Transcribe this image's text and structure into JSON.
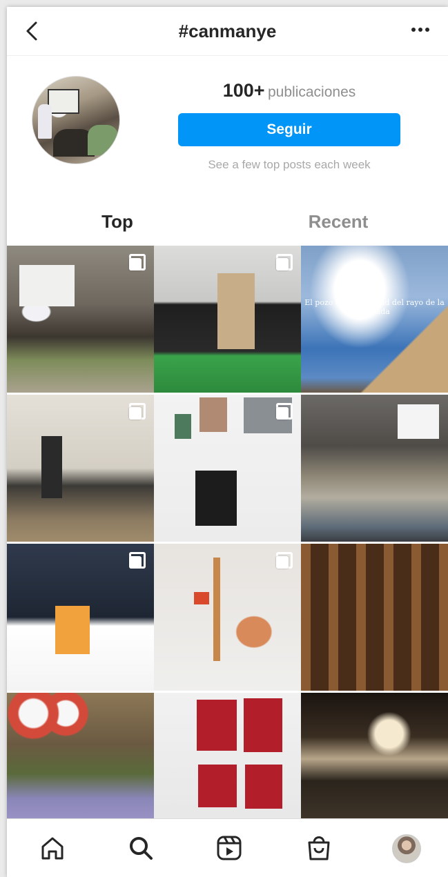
{
  "header": {
    "title": "#canmanye",
    "back_icon": "chevron-left-icon",
    "more_icon": "more-horizontal-icon"
  },
  "profile": {
    "posts_count": "100+",
    "posts_label": "publicaciones",
    "follow_label": "Seguir",
    "hint": "See a few top posts each week",
    "accent_color": "#0095f6"
  },
  "tabs": [
    {
      "label": "Top",
      "active": true
    },
    {
      "label": "Recent",
      "active": false
    }
  ],
  "grid": {
    "posts": [
      {
        "id": 1,
        "multi": true
      },
      {
        "id": 2,
        "multi": true
      },
      {
        "id": 3,
        "multi": false,
        "overlay_text": "El pozo de la felicidad del rayo de la cascada"
      },
      {
        "id": 4,
        "multi": true
      },
      {
        "id": 5,
        "multi": true
      },
      {
        "id": 6,
        "multi": false
      },
      {
        "id": 7,
        "multi": true
      },
      {
        "id": 8,
        "multi": true
      },
      {
        "id": 9,
        "multi": false
      },
      {
        "id": 10,
        "multi": false
      },
      {
        "id": 11,
        "multi": false
      },
      {
        "id": 12,
        "multi": false
      }
    ]
  },
  "bottom_nav": [
    {
      "icon": "home-icon"
    },
    {
      "icon": "search-icon"
    },
    {
      "icon": "reels-icon"
    },
    {
      "icon": "shop-icon"
    },
    {
      "icon": "profile-avatar"
    }
  ]
}
